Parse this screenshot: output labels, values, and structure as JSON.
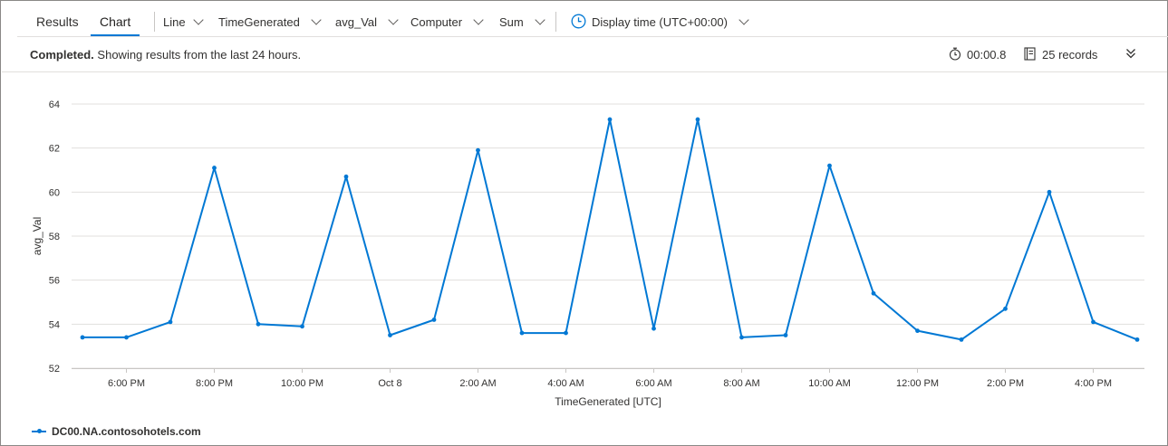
{
  "tabs": [
    {
      "label": "Results",
      "active": false
    },
    {
      "label": "Chart",
      "active": true
    }
  ],
  "toolbar": {
    "chart_type": "Line",
    "x_column": "TimeGenerated",
    "y_column": "avg_Val",
    "split_by": "Computer",
    "aggregation": "Sum",
    "display_time": "Display time (UTC+00:00)"
  },
  "status": {
    "state": "Completed.",
    "message": "Showing results from the last 24 hours.",
    "duration": "00:00.8",
    "records": "25 records"
  },
  "colors": {
    "accent": "#0078d4",
    "series": "#0078d4",
    "grid": "#e1dfdd"
  },
  "chart_data": {
    "type": "line",
    "xlabel": "TimeGenerated [UTC]",
    "ylabel": "avg_Val",
    "ylim": [
      52,
      64
    ],
    "yticks": [
      52,
      54,
      56,
      58,
      60,
      62,
      64
    ],
    "xlim": [
      "Oct 7 5:00 PM",
      "Oct 8 5:00 PM"
    ],
    "xtick_labels": [
      "6:00 PM",
      "8:00 PM",
      "10:00 PM",
      "Oct 8",
      "2:00 AM",
      "4:00 AM",
      "6:00 AM",
      "8:00 AM",
      "10:00 AM",
      "12:00 PM",
      "2:00 PM",
      "4:00 PM"
    ],
    "grid": true,
    "legend_position": "bottom-left",
    "x": [
      "Oct 7 5:00 PM",
      "Oct 7 6:00 PM",
      "Oct 7 7:00 PM",
      "Oct 7 8:00 PM",
      "Oct 7 9:00 PM",
      "Oct 7 10:00 PM",
      "Oct 7 11:00 PM",
      "Oct 8 12:00 AM",
      "Oct 8 1:00 AM",
      "Oct 8 2:00 AM",
      "Oct 8 3:00 AM",
      "Oct 8 4:00 AM",
      "Oct 8 5:00 AM",
      "Oct 8 6:00 AM",
      "Oct 8 7:00 AM",
      "Oct 8 8:00 AM",
      "Oct 8 9:00 AM",
      "Oct 8 10:00 AM",
      "Oct 8 11:00 AM",
      "Oct 8 12:00 PM",
      "Oct 8 1:00 PM",
      "Oct 8 2:00 PM",
      "Oct 8 3:00 PM",
      "Oct 8 4:00 PM",
      "Oct 8 5:00 PM"
    ],
    "series": [
      {
        "name": "DC00.NA.contosohotels.com",
        "values": [
          53.4,
          53.4,
          54.1,
          61.1,
          54.0,
          53.9,
          60.7,
          53.5,
          54.2,
          61.9,
          53.6,
          53.6,
          63.3,
          53.8,
          63.3,
          53.4,
          53.5,
          61.2,
          55.4,
          53.7,
          53.3,
          54.7,
          60.0,
          54.1,
          53.3
        ]
      }
    ]
  }
}
